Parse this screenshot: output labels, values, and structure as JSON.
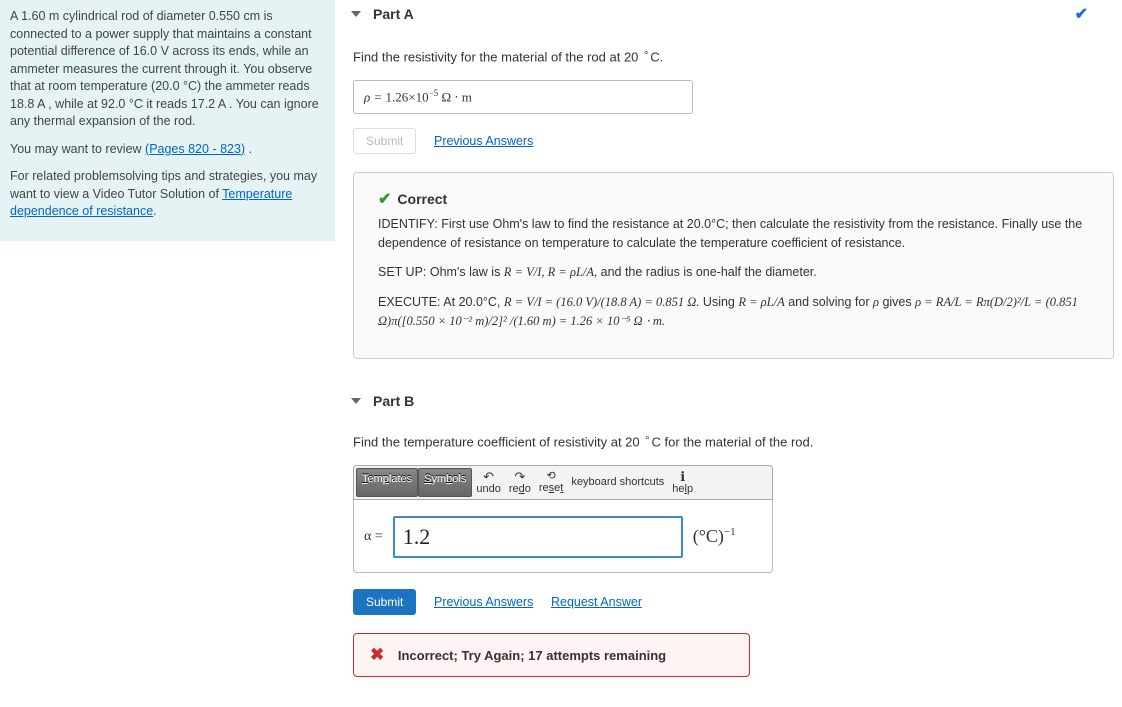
{
  "question": {
    "p1": "A 1.60 m cylindrical rod of diameter 0.550 cm is connected to a power supply that maintains a constant potential difference of 16.0 V across its ends, while an ammeter measures the current through it. You observe that at room temperature (20.0 °C) the ammeter reads 18.8 A , while at 92.0 °C it reads 17.2 A . You can ignore any thermal expansion of the rod.",
    "review_lead": "You may want to review ",
    "review_link": "(Pages 820 - 823)",
    "review_tail": " .",
    "related_lead": "For related problemsolving tips and strategies, you may want to view a Video Tutor Solution of ",
    "related_link": "Temperature dependence of resistance",
    "related_tail": "."
  },
  "partA": {
    "title": "Part A",
    "prompt": "Find the resistivity for the material of the rod at 20 °C.",
    "answer_prefix": "ρ =",
    "answer_value": " 1.26×10",
    "answer_exp": "−5",
    "answer_unit": " Ω ⋅ m",
    "submit": "Submit",
    "prev": "Previous Answers",
    "correct_label": "Correct",
    "fb1": "IDENTIFY: First use Ohm's law to find the resistance at 20.0°C; then calculate the resistivity from the resistance. Finally use the dependence of resistance on temperature to calculate the temperature coefficient of resistance.",
    "fb2_a": "SET UP: Ohm's law is ",
    "fb2_b": "R = V/I, R = ρL/A,",
    "fb2_c": " and the radius is one-half the diameter.",
    "fb3_a": "EXECUTE: At 20.0°C, ",
    "fb3_b": "R = V/I = (16.0 V)/(18.8 A) = 0.851 Ω.",
    "fb3_c": " Using ",
    "fb3_d": "R = ρL/A",
    "fb3_e": " and solving for ",
    "fb3_f": "ρ",
    "fb3_g": " gives ",
    "fb3_h": "ρ = RA/L = Rπ(D/2)²/L = (0.851 Ω)π([0.550 × 10⁻² m)/2]² /(1.60 m) = 1.26 × 10⁻⁵ Ω ⋅ m."
  },
  "partB": {
    "title": "Part B",
    "prompt": "Find the temperature coefficient of resistivity at 20 °C for the material of the rod.",
    "toolbar": {
      "templates": "Templates",
      "symbols": "Symbols",
      "undo": "undo",
      "redo": "redo",
      "reset": "reset",
      "keyboard": "keyboard shortcuts",
      "help": "help"
    },
    "alpha": "α =",
    "input_value": "1.2",
    "unit": "(°C)",
    "unit_exp": "−1",
    "submit": "Submit",
    "prev": "Previous Answers",
    "req": "Request Answer",
    "incorrect": "Incorrect; Try Again; 17 attempts remaining"
  }
}
